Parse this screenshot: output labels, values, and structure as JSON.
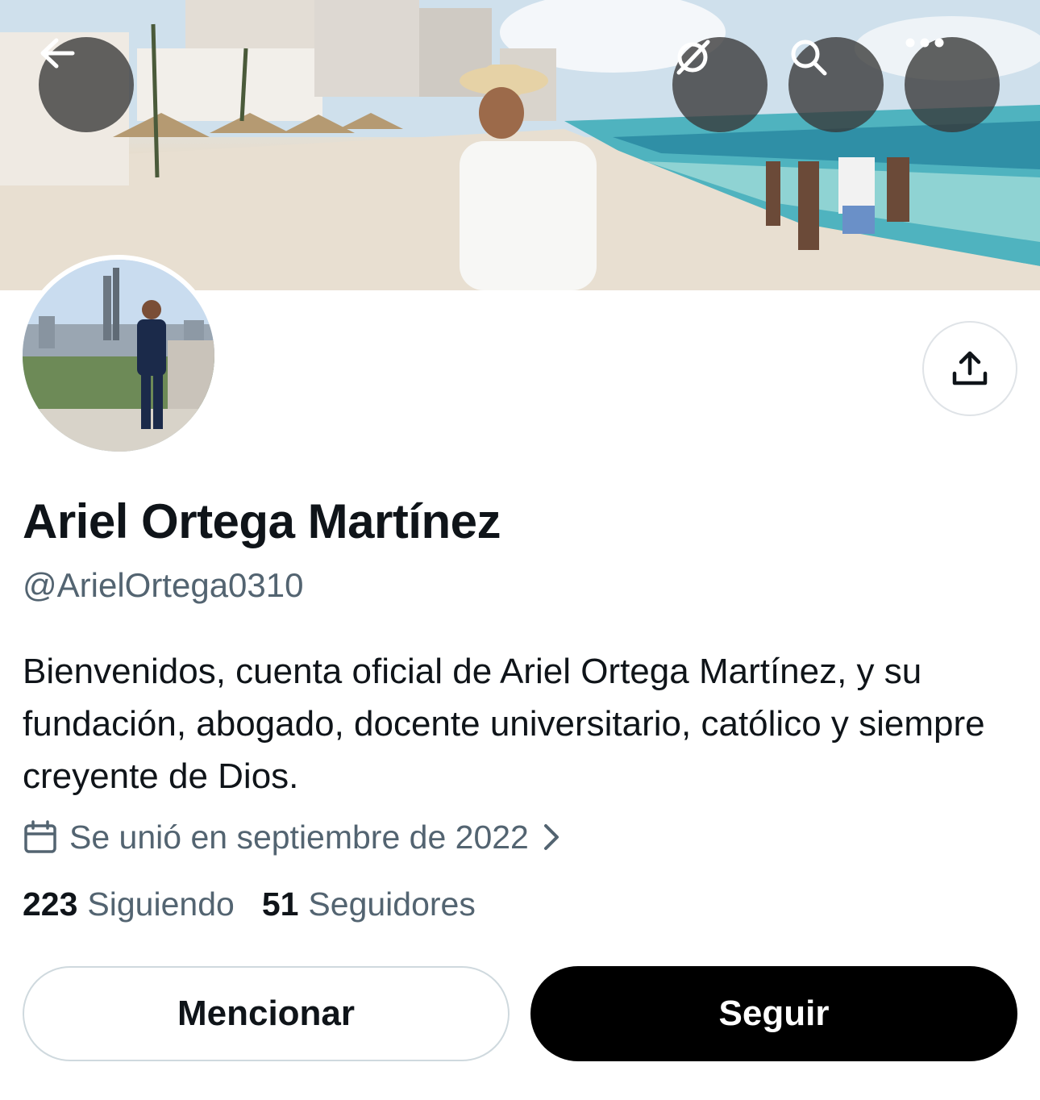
{
  "profile": {
    "name": "Ariel Ortega Martínez",
    "handle": "@ArielOrtega0310",
    "bio": "Bienvenidos, cuenta oficial de Ariel Ortega Martínez, y su fundación, abogado, docente universitario, católico y siempre creyente de Dios.",
    "joined": "Se unió en septiembre de 2022",
    "following_count": "223",
    "following_label": "Siguiendo",
    "followers_count": "51",
    "followers_label": "Seguidores"
  },
  "actions": {
    "mention_label": "Mencionar",
    "follow_label": "Seguir"
  },
  "icons": {
    "back": "arrow-left-icon",
    "translate": "grok-slash-icon",
    "search": "search-icon",
    "more": "ellipsis-icon",
    "share": "share-upload-icon",
    "calendar": "calendar-icon",
    "chevron": "chevron-right-icon"
  },
  "colors": {
    "primary_text": "#0f1419",
    "secondary_text": "#536471",
    "follow_bg": "#000000",
    "border": "#cfd9de"
  }
}
